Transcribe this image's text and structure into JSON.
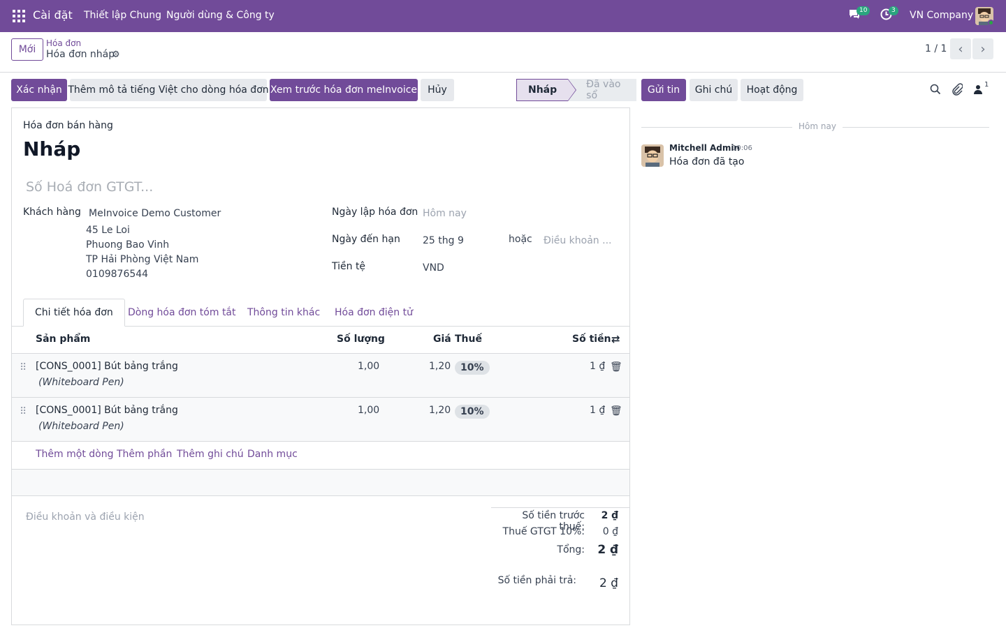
{
  "topbar": {
    "brand": "Cài đặt",
    "menu": [
      "Thiết lập Chung",
      "Người dùng & Công ty"
    ],
    "messages_count": "10",
    "activities_count": "3",
    "company": "VN Company"
  },
  "control_panel": {
    "new_button": "Mới",
    "breadcrumb_parent": "Hóa đơn",
    "breadcrumb_current": "Hóa đơn nháp",
    "pager": "1 / 1"
  },
  "actions": {
    "confirm": "Xác nhận",
    "add_vn_desc": "Thêm mô tả tiếng Việt cho dòng hóa đơn",
    "preview": "Xem trước hóa đơn meInvoice",
    "cancel": "Hủy"
  },
  "status": {
    "draft": "Nháp",
    "posted": "Đã vào sổ"
  },
  "form": {
    "doc_type": "Hóa đơn bán hàng",
    "title": "Nháp",
    "invoice_number_placeholder": "Số Hoá đơn GTGT...",
    "customer_label": "Khách hàng",
    "customer_name": "MeInvoice Demo Customer",
    "address1": "45 Le Loi",
    "address2": "Phuong Bao Vinh",
    "address3": "TP Hải Phòng Việt Nam",
    "phone": "0109876544",
    "invoice_date_label": "Ngày lập hóa đơn",
    "invoice_date_placeholder": "Hôm nay",
    "due_date_label": "Ngày đến hạn",
    "due_date": "25 thg 9",
    "or": "hoặc",
    "payment_terms_placeholder": "Điều khoản ...",
    "currency_label": "Tiền tệ",
    "currency": "VND"
  },
  "tabs": [
    "Chi tiết hóa đơn",
    "Dòng hóa đơn tóm tắt",
    "Thông tin khác",
    "Hóa đơn điện tử"
  ],
  "table": {
    "headers": {
      "product": "Sản phẩm",
      "qty": "Số lượng",
      "price": "Giá",
      "tax": "Thuế",
      "amount": "Số tiền"
    },
    "rows": [
      {
        "product": "[CONS_0001] Bút bảng trắng",
        "desc": "(Whiteboard Pen)",
        "qty": "1,00",
        "price": "1,20",
        "tax": "10%",
        "amount": "1 ₫"
      },
      {
        "product": "[CONS_0001] Bút bảng trắng",
        "desc": "(Whiteboard Pen)",
        "qty": "1,00",
        "price": "1,20",
        "tax": "10%",
        "amount": "1 ₫"
      }
    ],
    "add_links": [
      "Thêm một dòng",
      "Thêm phần",
      "Thêm ghi chú",
      "Danh mục"
    ]
  },
  "terms_placeholder": "Điều khoản và điều kiện",
  "totals": {
    "untaxed_label": "Số tiền trước thuế:",
    "untaxed": "2 ₫",
    "vat_label": "Thuế GTGT 10%:",
    "vat": "0 ₫",
    "total_label": "Tổng:",
    "total": "2 ₫",
    "due_label": "Số tiền phải trả:",
    "due": "2 ₫"
  },
  "chatter": {
    "send": "Gửi tin",
    "note": "Ghi chú",
    "activity": "Hoạt động",
    "followers": "1",
    "today": "Hôm nay",
    "author": "Mitchell Admin",
    "time": "10:06",
    "message": "Hóa đơn đã tạo"
  },
  "colors": {
    "brand": "#714b99",
    "badge": "#2aa57e"
  }
}
